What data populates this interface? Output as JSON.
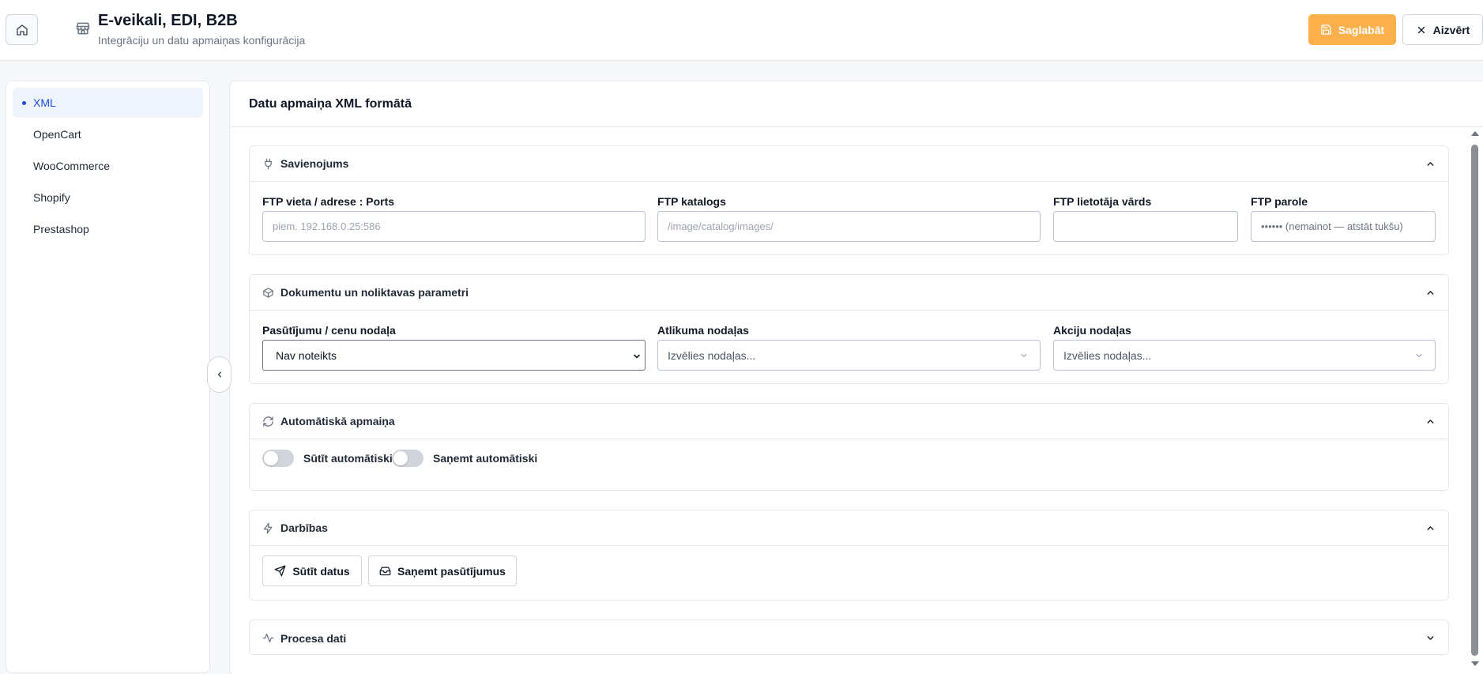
{
  "header": {
    "title": "E-veikali, EDI, B2B",
    "subtitle": "Integrāciju un datu apmaiņas konfigurācija",
    "save_label": "Saglabāt",
    "close_label": "Aizvērt"
  },
  "sidebar": {
    "items": [
      {
        "label": "XML",
        "active": true
      },
      {
        "label": "OpenCart"
      },
      {
        "label": "WooCommerce"
      },
      {
        "label": "Shopify"
      },
      {
        "label": "Prestashop"
      }
    ]
  },
  "main": {
    "title": "Datu apmaiņa XML formātā",
    "connection": {
      "title": "Savienojums",
      "ftp_host_label": "FTP vieta / adrese : Ports",
      "ftp_host_placeholder": "piem. 192.168.0.25:586",
      "ftp_dir_label": "FTP katalogs",
      "ftp_dir_placeholder": "/image/catalog/images/",
      "ftp_user_label": "FTP lietotāja vārds",
      "ftp_user_value": "",
      "ftp_pass_label": "FTP parole",
      "ftp_pass_placeholder": "•••••• (nemainot — atstāt tukšu)"
    },
    "documents": {
      "title": "Dokumentu un noliktavas parametri",
      "orders_label": "Pasūtījumu / cenu nodaļa",
      "orders_value": "Nav noteikts",
      "stock_label": "Atlikuma nodaļas",
      "stock_placeholder": "Izvēlies nodaļas...",
      "promo_label": "Akciju nodaļas",
      "promo_placeholder": "Izvēlies nodaļas..."
    },
    "auto": {
      "title": "Automātiskā apmaiņa",
      "send_label": "Sūtīt automātiski",
      "receive_label": "Saņemt automātiski",
      "send_on": false,
      "receive_on": false
    },
    "actions": {
      "title": "Darbības",
      "send_btn": "Sūtīt datus",
      "receive_btn": "Saņemt pasūtījumus"
    },
    "process": {
      "title": "Procesa dati"
    }
  },
  "colors": {
    "accent": "#fbb04c",
    "active_nav": "#1d4ed8"
  }
}
